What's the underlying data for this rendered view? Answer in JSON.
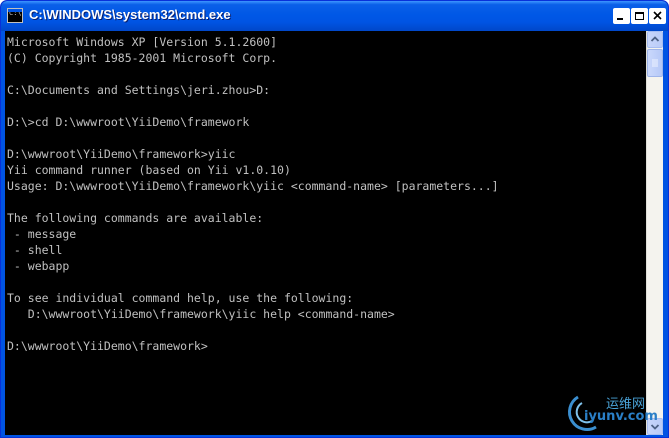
{
  "window": {
    "title": "C:\\WINDOWS\\system32\\cmd.exe",
    "icon": "cmd-icon"
  },
  "console": {
    "lines": [
      "Microsoft Windows XP [Version 5.1.2600]",
      "(C) Copyright 1985-2001 Microsoft Corp.",
      "",
      "C:\\Documents and Settings\\jeri.zhou>D:",
      "",
      "D:\\>cd D:\\wwwroot\\YiiDemo\\framework",
      "",
      "D:\\wwwroot\\YiiDemo\\framework>yiic",
      "Yii command runner (based on Yii v1.0.10)",
      "Usage: D:\\wwwroot\\YiiDemo\\framework\\yiic <command-name> [parameters...]",
      "",
      "The following commands are available:",
      " - message",
      " - shell",
      " - webapp",
      "",
      "To see individual command help, use the following:",
      "   D:\\wwwroot\\YiiDemo\\framework\\yiic help <command-name>",
      "",
      "D:\\wwwroot\\YiiDemo\\framework>"
    ]
  },
  "watermark": {
    "top": "运维网",
    "bottom": "iyunv.com"
  },
  "colors": {
    "titlebar": "#0054e3",
    "console_bg": "#000000",
    "console_fg": "#c0c0c0",
    "close_button": "#e04a2c"
  }
}
